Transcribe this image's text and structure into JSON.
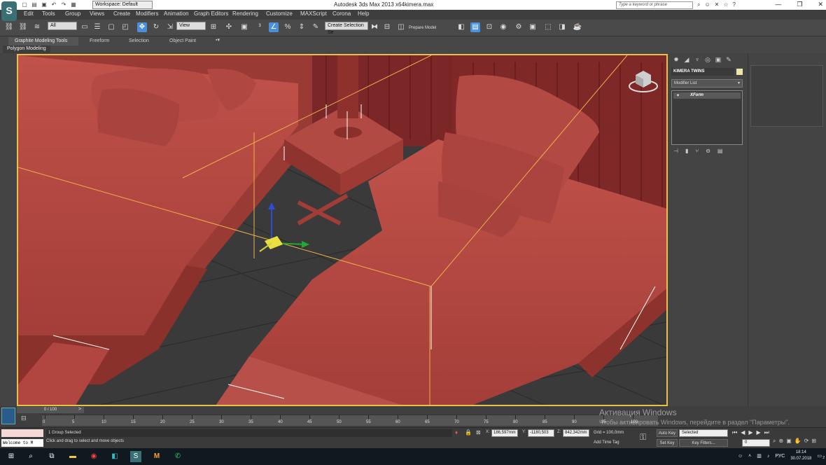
{
  "titlebar": {
    "workspace": "Workspace: Default",
    "app_title": "Autodesk 3ds Max  2013 x64",
    "file": "kimera.max",
    "search_placeholder": "Type a keyword or phrase"
  },
  "menu": [
    "Edit",
    "Tools",
    "Group",
    "Views",
    "Create",
    "Modifiers",
    "Animation",
    "Graph Editors",
    "Rendering",
    "Customize",
    "MAXScript",
    "Corona",
    "Help"
  ],
  "toolbar": {
    "filter": "All",
    "ref_coord": "View",
    "selection_set": "Create Selection Se",
    "prepare_model": "Prepare Model"
  },
  "ribbon": {
    "tabs": [
      "Graphite Modeling Tools",
      "Freeform",
      "Selection",
      "Object Paint"
    ],
    "panel": "Polygon Modeling"
  },
  "command_panel": {
    "object_name": "KIMERA TWINS",
    "object_color": "#ece6a8",
    "modifier_list": "Modifier List",
    "stack_item": "XForm"
  },
  "timeline": {
    "slider": "0 / 100",
    "ticks": [
      "0",
      "5",
      "10",
      "15",
      "20",
      "25",
      "30",
      "35",
      "40",
      "45",
      "50",
      "55",
      "60",
      "65",
      "70",
      "75",
      "80",
      "85",
      "90",
      "95",
      "100"
    ]
  },
  "status": {
    "listener": "Welcome to M",
    "selected": "1 Group Selected",
    "prompt": "Click and drag to select and move objects",
    "x_label": "X:",
    "x": "186,597mm",
    "y_label": "Y:",
    "y": "-1180,503",
    "z_label": "Z:",
    "z": "842,342mm",
    "grid": "Grid = 100,0mm",
    "add_time_tag": "Add Time Tag",
    "auto_key": "Auto Key",
    "set_key": "Set Key",
    "key_mode": "Selected",
    "key_filters": "Key Filters...",
    "frame": "0"
  },
  "watermark": {
    "line1": "Активация Windows",
    "line2": "Чтобы активировать Windows, перейдите в раздел \"Параметры\"."
  },
  "taskbar": {
    "lang": "РУС",
    "time": "18:14",
    "date": "30.07.2018",
    "notifications": "2"
  }
}
